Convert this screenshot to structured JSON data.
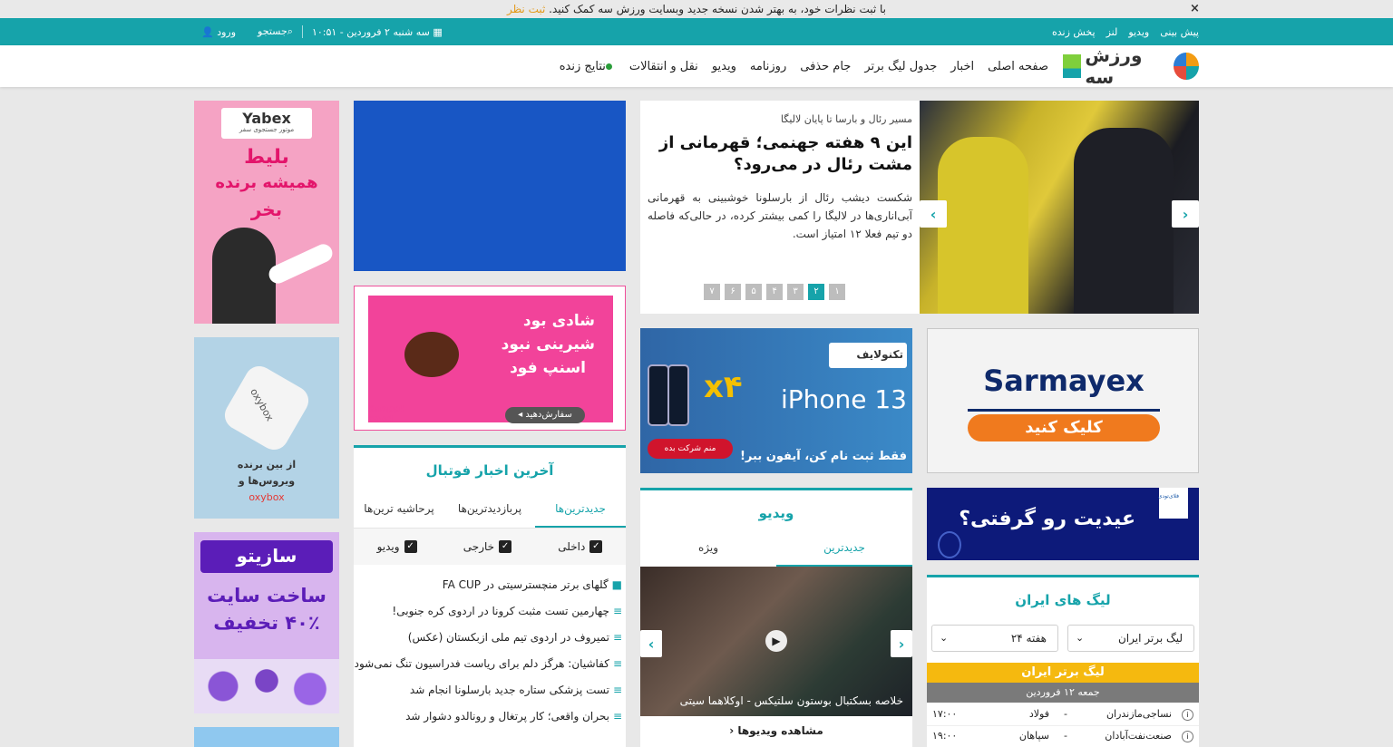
{
  "notice": {
    "text": "با ثبت نظرات خود، به بهتر شدن نسخه جدید وبسایت ورزش سه کمک کنید.",
    "link": "ثبت نظر",
    "close": "×"
  },
  "topbar": {
    "links": [
      "پیش بینی",
      "ویدیو",
      "لنز",
      "پخش زنده"
    ],
    "date": "سه شنبه ۲ فروردین - ۱۰:۵۱",
    "search": "جستجو",
    "login": "ورود"
  },
  "nav": {
    "logo": "ورزش سه",
    "items": [
      "صفحه اصلی",
      "اخبار",
      "جدول لیگ برتر",
      "جام حذفی",
      "روزنامه",
      "ویدیو",
      "نقل و انتقالات",
      "نتایج زنده"
    ]
  },
  "slider": {
    "kicker": "مسیر رئال و بارسا تا پایان لالیگا",
    "title": "این ۹ هفته جهنمی؛ قهرمانی از مشت رئال در می‌رود؟",
    "desc": "شکست دیشب رئال از بارسلونا خوشبینی به قهرمانی آبی‌اناری‌ها در لالیگا را کمی بیشتر کرده، در حالی‌که فاصله دو تیم فعلا ۱۲ امتیاز است.",
    "pages": [
      "۱",
      "۲",
      "۳",
      "۴",
      "۵",
      "۶",
      "۷"
    ],
    "active": 1
  },
  "ads": {
    "yabex": {
      "brand": "Yabex",
      "sub": "موتور جستجوی سفر",
      "line1": "بلیط",
      "line2": "همیشه برنده",
      "line3": "بخر"
    },
    "snapp": {
      "line1": "شادی بود",
      "line2": "شیرینی نبود",
      "line3": "اسنپ فود",
      "btn": "سفارش‌دهید ◂",
      "brand": "Snapp! Food"
    },
    "iphone": {
      "brand": "تکنولایف",
      "model": "iPhone 13",
      "x4": "x۴",
      "btn": "منم شرکت بده",
      "tag": "فقط ثبت نام کن، آیفون ببر!"
    },
    "sarmayex": {
      "brand": "Sarmayex",
      "btn": "کلیک کنید"
    },
    "oxy": {
      "brand": "oxybox",
      "line1": "از بین برنده",
      "line2": "ویروس‌ها و",
      "brand2": "oxybox"
    },
    "eid": {
      "text": "عیدیت رو گرفتی؟",
      "brand": "فلای‌تودی"
    },
    "sazito": {
      "brand": "سازیتو",
      "line1": "ساخت سایت",
      "line2": "۴۰٪ تخفیف"
    }
  },
  "news": {
    "title": "آخرین اخبار فوتبال",
    "tabs": [
      "جدیدترین‌ها",
      "پربازدیدترین‌ها",
      "پرحاشیه ترین‌ها"
    ],
    "filters": [
      "داخلی",
      "خارجی",
      "ویدیو"
    ],
    "items": [
      "گلهای برتر منچسترسیتی در FA CUP",
      "چهارمین تست مثبت کرونا در اردوی کره جنوبی!",
      "تمیروف در اردوی تیم ملی ازبکستان (عکس)",
      "کفاشیان: هرگز دلم برای ریاست فدراسیون تنگ نمی‌شود",
      "تست پزشکی ستاره جدید بارسلونا انجام شد",
      "بحران واقعی؛ کار پرتغال و رونالدو دشوار شد"
    ]
  },
  "video": {
    "title": "ویدیو",
    "tabs": [
      "جدیدترین",
      "ویژه"
    ],
    "caption": "خلاصه بسکتبال بوستون سلتیکس - اوکلاهما سیتی",
    "more": "مشاهده ویدیوها"
  },
  "league": {
    "title": "لیگ های ایران",
    "select1": "لیگ برتر ایران",
    "select2": "هفته ۲۴",
    "bar": "لیگ برتر ایران",
    "date": "جمعه ۱۲ فروردین",
    "matches": [
      {
        "home": "نساجی‌مازندران",
        "away": "فولاد",
        "time": "۱۷:۰۰"
      },
      {
        "home": "صنعت‌نفت‌آبادان",
        "away": "سپاهان",
        "time": "۱۹:۰۰"
      }
    ]
  }
}
